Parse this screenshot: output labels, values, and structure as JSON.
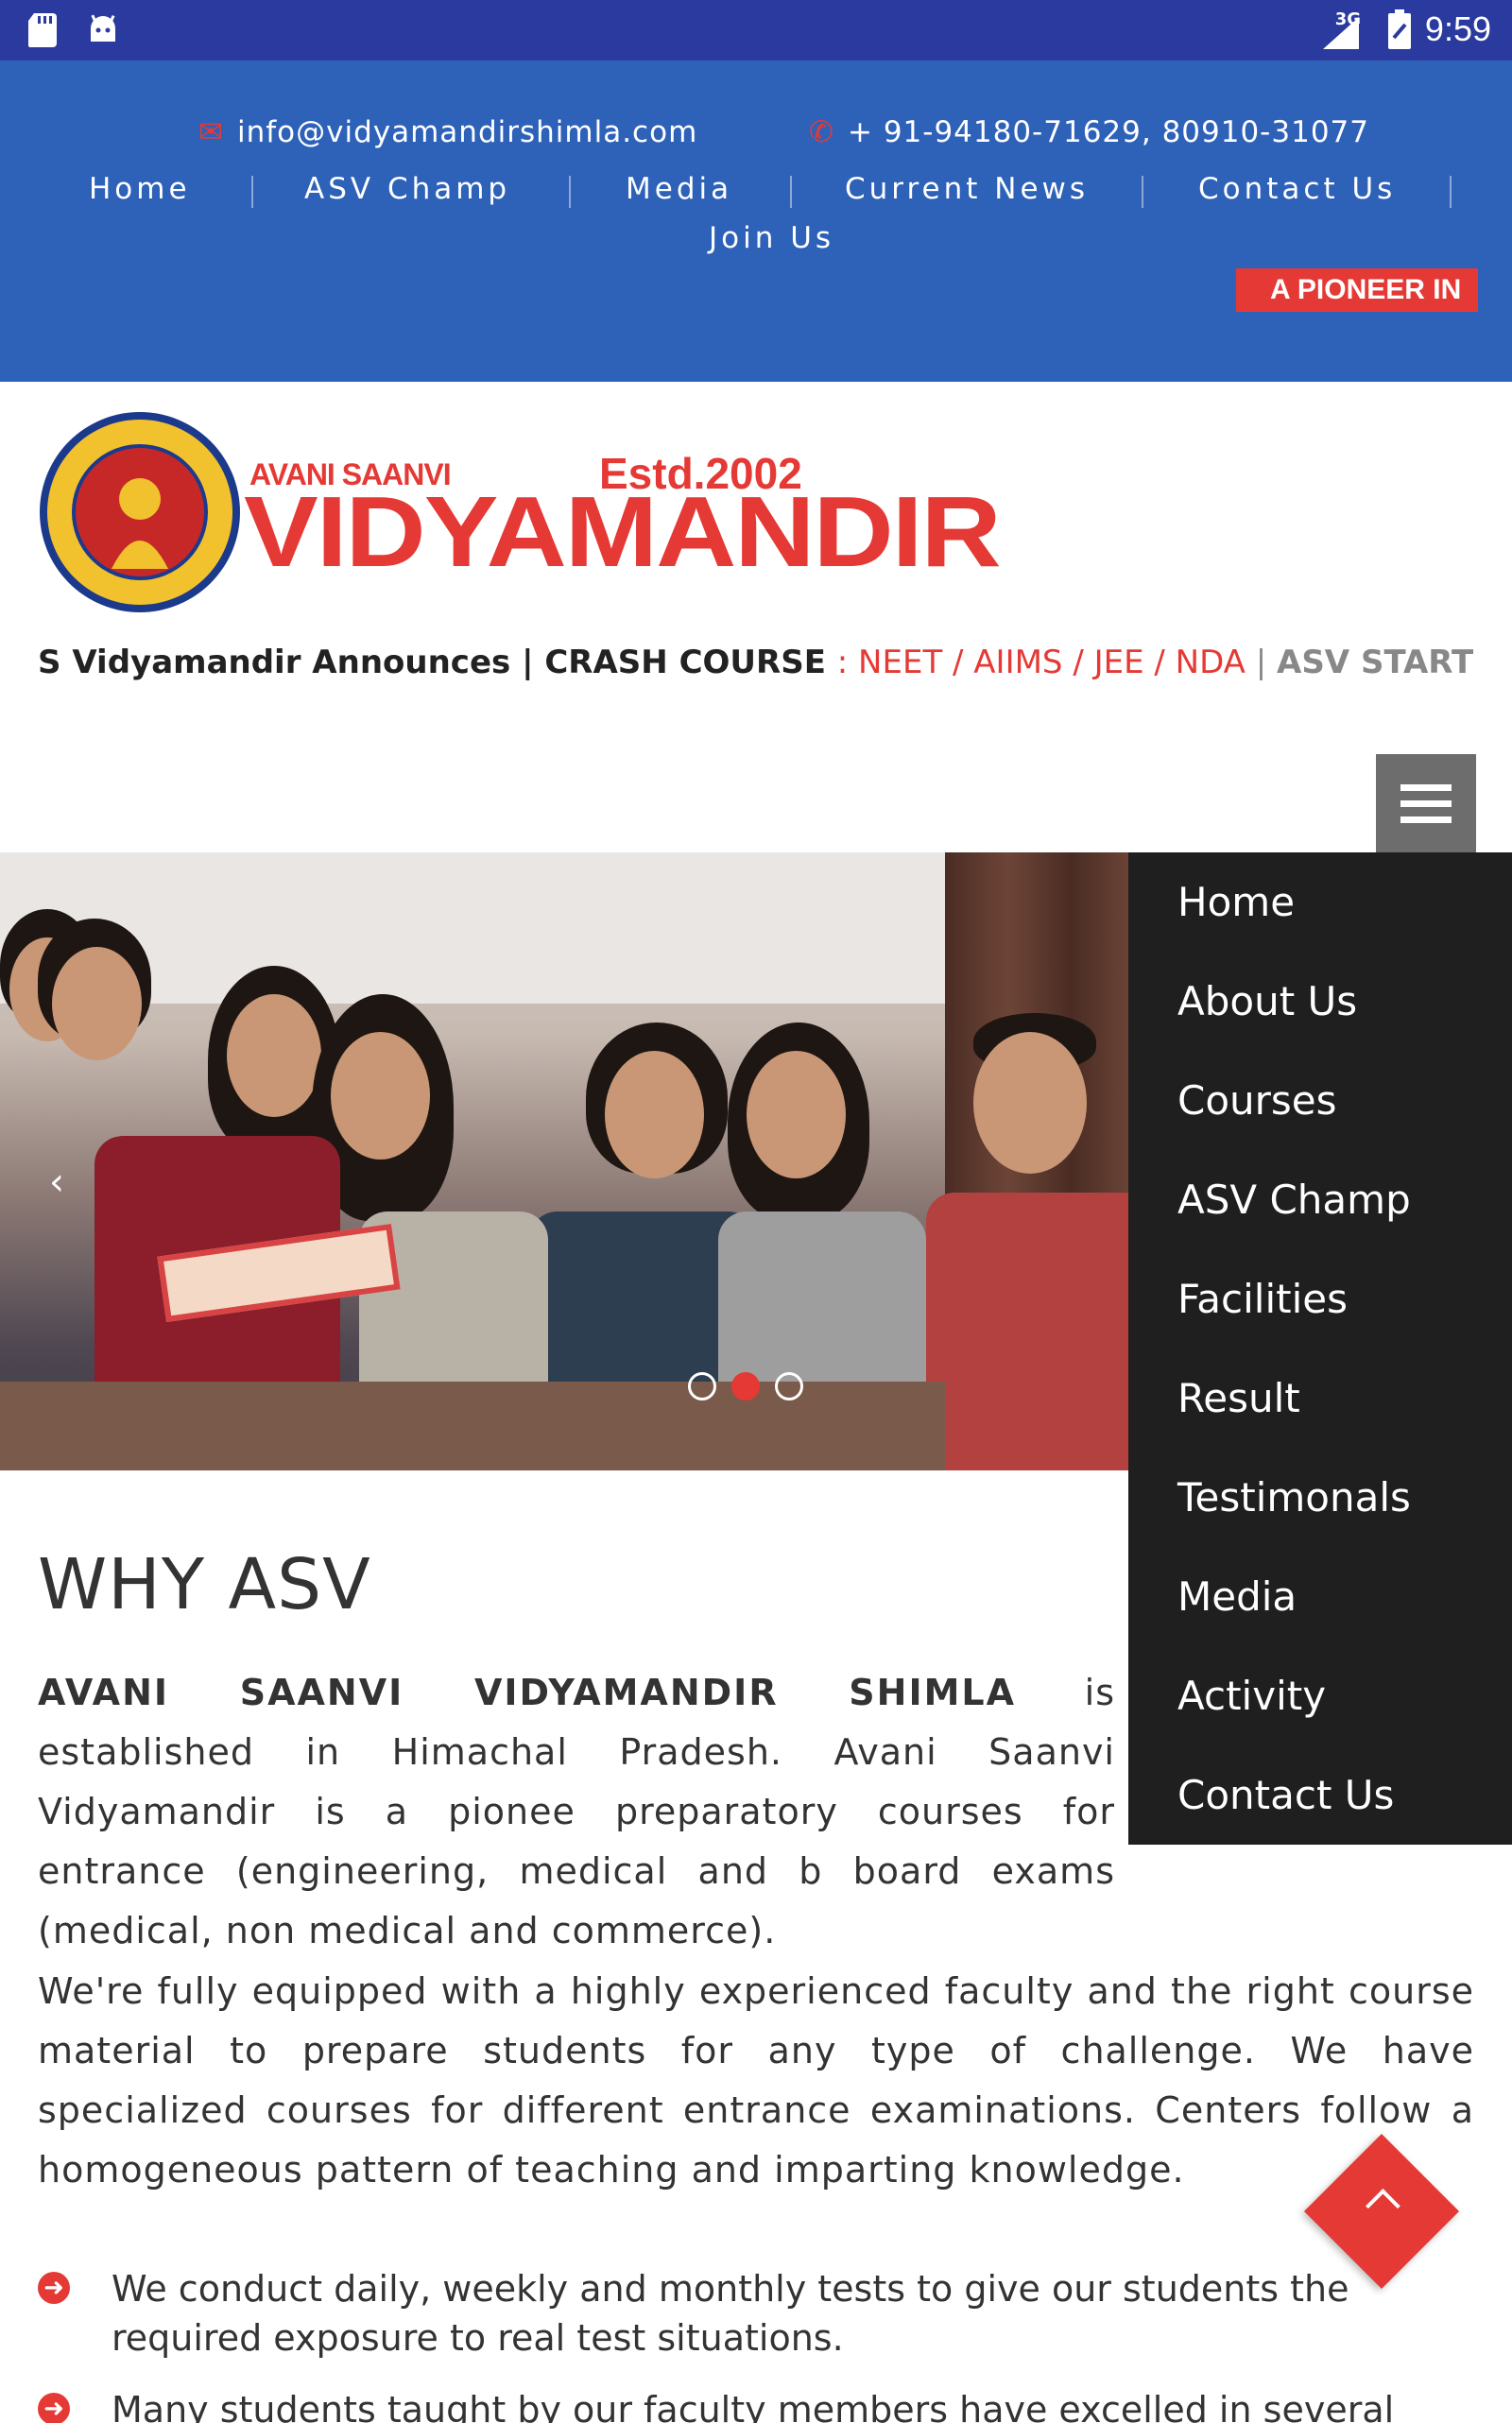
{
  "status_bar": {
    "time": "9:59",
    "network": "3G"
  },
  "top_bar": {
    "email": "info@vidyamandirshimla.com",
    "phone": "+ 91-94180-71629, 80910-31077",
    "nav": [
      "Home",
      "ASV Champ",
      "Media",
      "Current News",
      "Contact Us",
      "Join Us"
    ],
    "pioneer_banner": "A PIONEER IN"
  },
  "brand": {
    "small": "AVANI SAANVI",
    "estd": "Estd.2002",
    "big": "VIDYAMANDIR"
  },
  "ticker": {
    "part1": "S Vidyamandir Announces | CRASH COURSE ",
    "part2": ": NEET / AIIMS / JEE / NDA ",
    "sep": "| ",
    "part3": "ASV STARTED COA"
  },
  "drawer_menu": [
    "Home",
    "About Us",
    "Courses",
    "ASV Champ",
    "Facilities",
    "Result",
    "Testimonals",
    "Media",
    "Activity",
    "Contact Us"
  ],
  "slider": {
    "active_index": 1,
    "count": 3
  },
  "why": {
    "title": "WHY ASV",
    "p1_bold": "AVANI SAANVI VIDYAMANDIR SHIMLA",
    "p1_rest": " is established in Himachal Pradesh. Avani Saanvi Vidyamandir is a pionee preparatory courses for entrance (engineering, medical and b board exams (medical, non medical and commerce).",
    "p2": "We're fully equipped with a highly experienced faculty and the right course material to prepare students for any type of challenge. We have specialized courses for different entrance examinations. Centers follow a homogeneous pattern of teaching and imparting knowledge.",
    "bullets": [
      "We conduct daily, weekly and monthly tests to give our students the required exposure to real test situations.",
      "Many students taught by our faculty members have excelled in several board"
    ]
  },
  "colors": {
    "accent": "#e53935",
    "topbar": "#2e62b9",
    "statusbar": "#2a3a9e",
    "drawer": "#1f1f1f"
  }
}
